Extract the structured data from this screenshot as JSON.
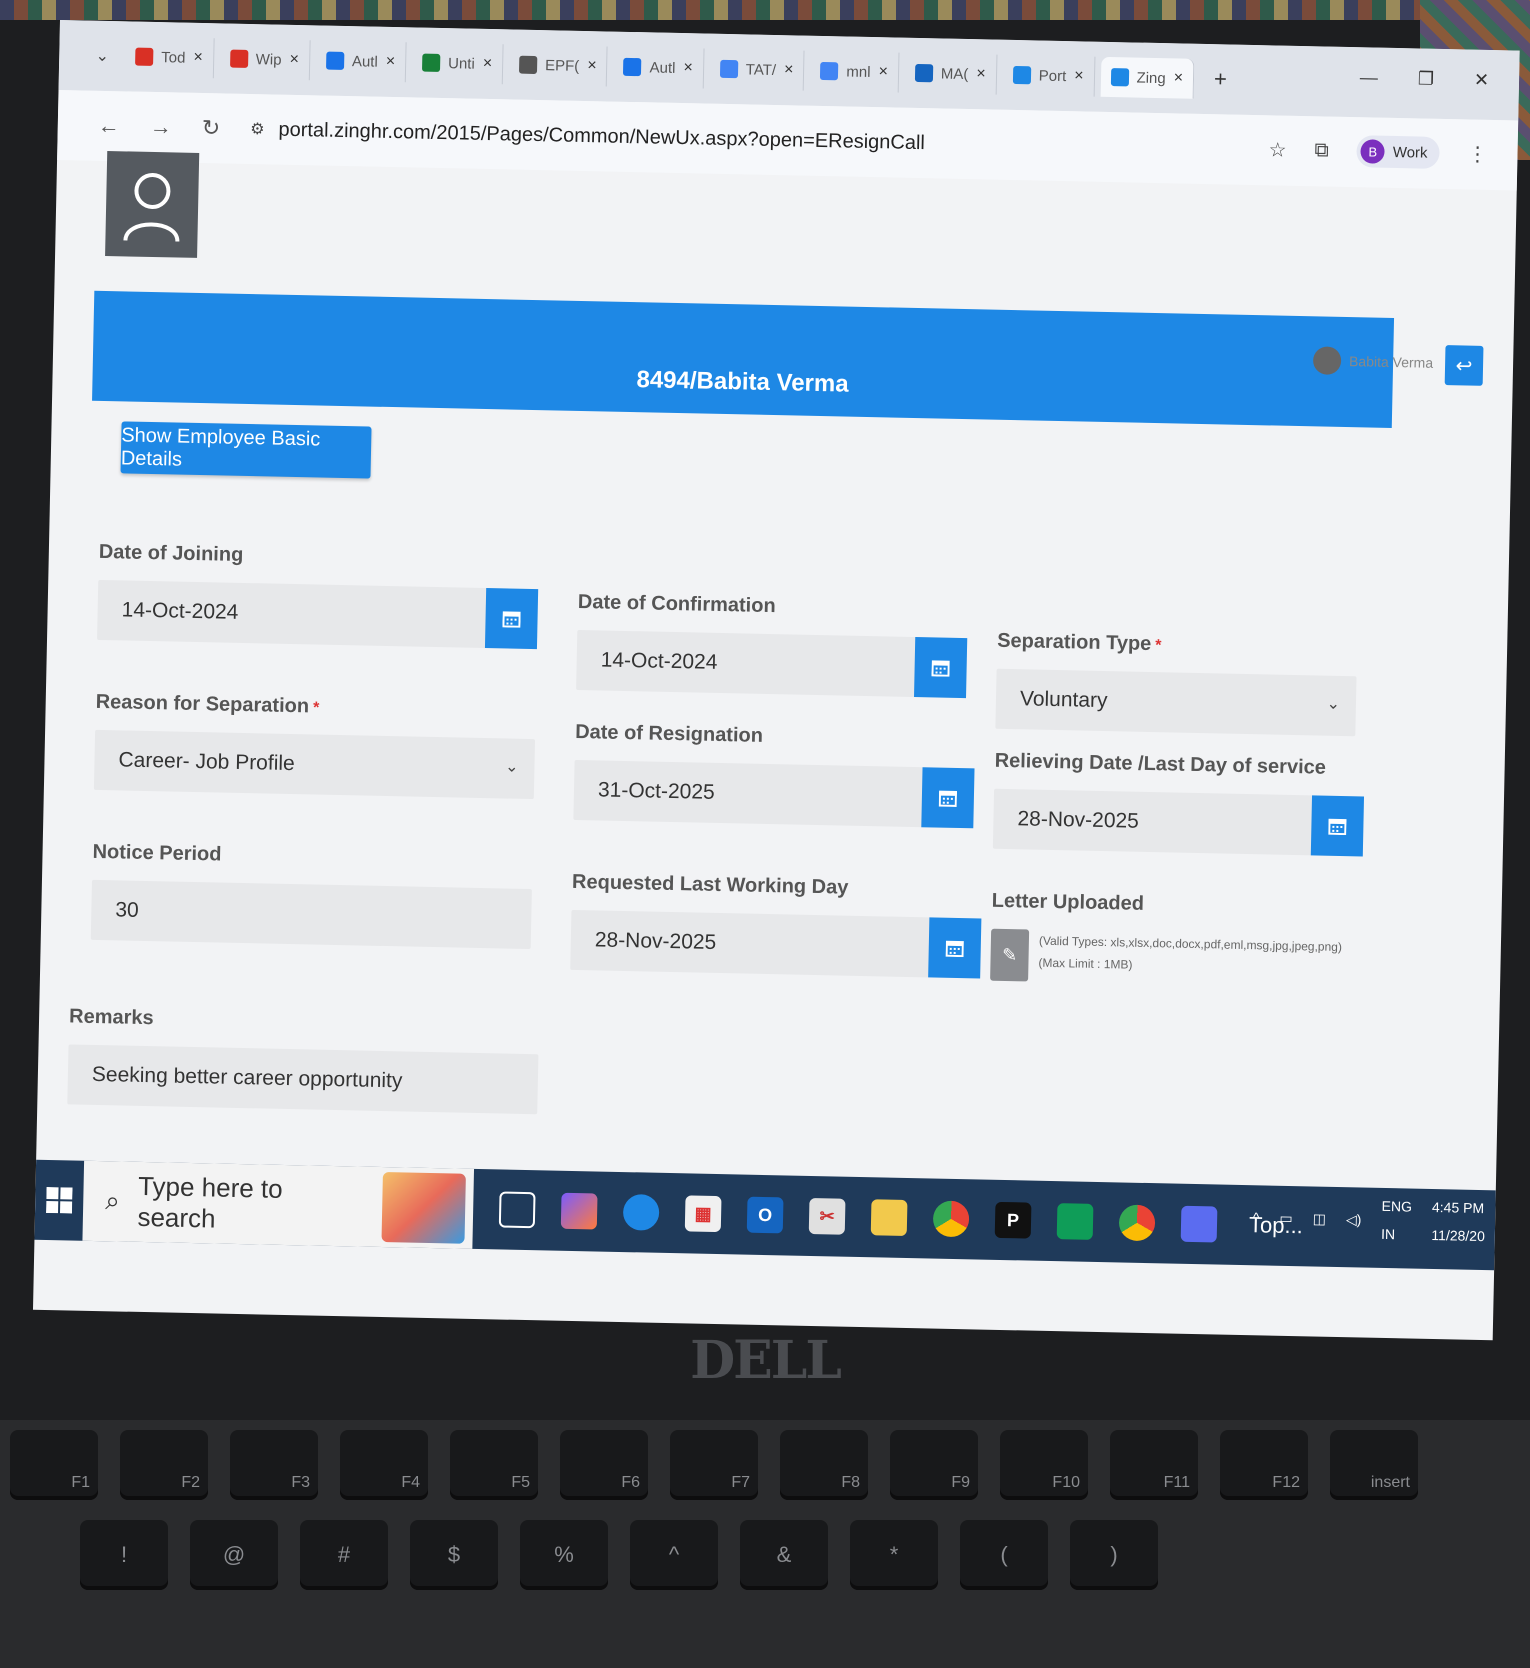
{
  "browser": {
    "tabs": [
      {
        "label": "Tod",
        "icon": "gmail-icon",
        "color": "#d93025"
      },
      {
        "label": "Wip",
        "icon": "gmail-icon",
        "color": "#d93025"
      },
      {
        "label": "Autl",
        "icon": "autl-icon",
        "color": "#1a73e8"
      },
      {
        "label": "Unti",
        "icon": "sheets-icon",
        "color": "#188038"
      },
      {
        "label": "EPF(",
        "icon": "globe-icon",
        "color": "#555555"
      },
      {
        "label": "Autl",
        "icon": "autl-icon",
        "color": "#1a73e8"
      },
      {
        "label": "TAT/",
        "icon": "google-icon",
        "color": "#4285f4"
      },
      {
        "label": "mnl",
        "icon": "google-icon",
        "color": "#4285f4"
      },
      {
        "label": "MA(",
        "icon": "pin-icon",
        "color": "#1565c0"
      },
      {
        "label": "Port",
        "icon": "zing-icon",
        "color": "#1e88e5"
      },
      {
        "label": "Zing",
        "icon": "zing-icon",
        "color": "#1e88e5"
      }
    ],
    "url": "portal.zinghr.com/2015/Pages/Common/NewUx.aspx?open=EResignCall",
    "profile": {
      "initial": "B",
      "label": "Work"
    }
  },
  "header": {
    "user_name": "Babita Verma",
    "title": "8494/Babita Verma"
  },
  "actions": {
    "show_details": "Show Employee Basic Details"
  },
  "form": {
    "date_of_joining": {
      "label": "Date of Joining",
      "value": "14-Oct-2024"
    },
    "date_of_confirmation": {
      "label": "Date of Confirmation",
      "value": "14-Oct-2024"
    },
    "separation_type": {
      "label": "Separation Type",
      "required_mark": "*",
      "value": "Voluntary"
    },
    "reason_for_separation": {
      "label": "Reason for Separation",
      "required_mark": "*",
      "value": "Career- Job Profile"
    },
    "date_of_resignation": {
      "label": "Date of Resignation",
      "value": "31-Oct-2025"
    },
    "relieving_date": {
      "label": "Relieving Date /Last Day of service",
      "value": "28-Nov-2025"
    },
    "notice_period": {
      "label": "Notice Period",
      "value": "30"
    },
    "requested_last_working_day": {
      "label": "Requested Last Working Day",
      "value": "28-Nov-2025"
    },
    "letter_uploaded": {
      "label": "Letter Uploaded",
      "valid_types": "(Valid Types: xls,xlsx,doc,docx,pdf,eml,msg,jpg,jpeg,png)",
      "max_limit": "(Max Limit : 1MB)"
    },
    "remarks": {
      "label": "Remarks",
      "value": "Seeking better career opportunity"
    }
  },
  "taskbar": {
    "search_placeholder": "Type here to search",
    "pinned_label": "Top...",
    "lang_top": "ENG",
    "lang_bottom": "IN",
    "time": "4:45 PM",
    "date": "11/28/20"
  },
  "hardware": {
    "brand": "DELL",
    "fn_keys": [
      "F1",
      "F2",
      "F3",
      "F4",
      "F5",
      "F6",
      "F7",
      "F8",
      "F9",
      "F10",
      "F11",
      "F12",
      "insert"
    ],
    "num_keys": [
      "!",
      "@",
      "#",
      "$",
      "%",
      "^",
      "&",
      "*",
      "(",
      ")"
    ]
  },
  "colors": {
    "primary": "#1e88e5",
    "field_bg": "#e7e8ea",
    "taskbar": "#1f3a5a"
  }
}
